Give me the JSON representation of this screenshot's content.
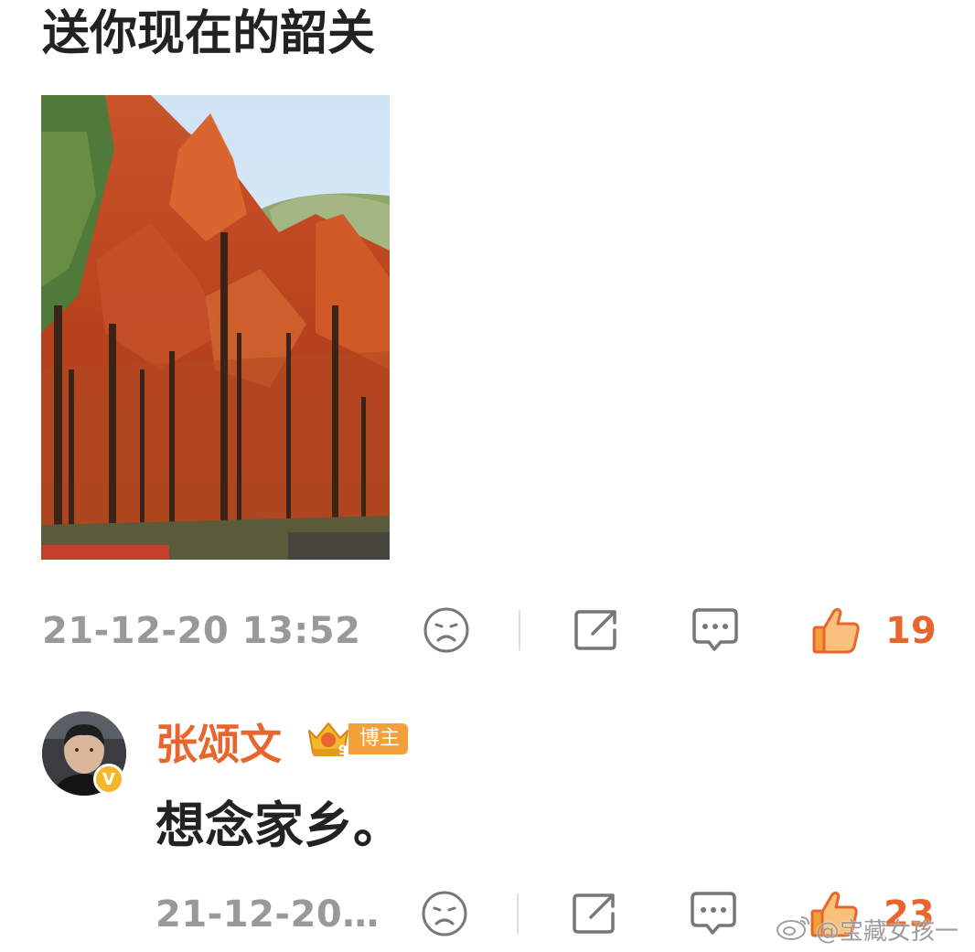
{
  "post": {
    "text": "送你现在的韶关",
    "photo_icon": "autumn-redwood-forest-photo"
  },
  "post_actions": {
    "timestamp": "21-12-20 13:52",
    "like_count": "19",
    "icons": [
      "sad-face-icon",
      "share-icon",
      "comment-icon",
      "thumbs-up-icon"
    ]
  },
  "comment": {
    "author": "张颂文",
    "rank_icon": "crown-level-9-icon",
    "rank_level": "9",
    "badge": "博主",
    "verified_mark": "V",
    "text": "想念家乡。"
  },
  "comment_actions": {
    "timestamp": "21-12-20…",
    "like_count": "23"
  },
  "watermark": {
    "text": "@宝藏女孩一",
    "icon": "weibo-logo-icon"
  },
  "colors": {
    "accent": "#e8662d",
    "muted": "#999999",
    "text": "#222222",
    "badge": "#f3a03a",
    "verified": "#f3b72a"
  }
}
